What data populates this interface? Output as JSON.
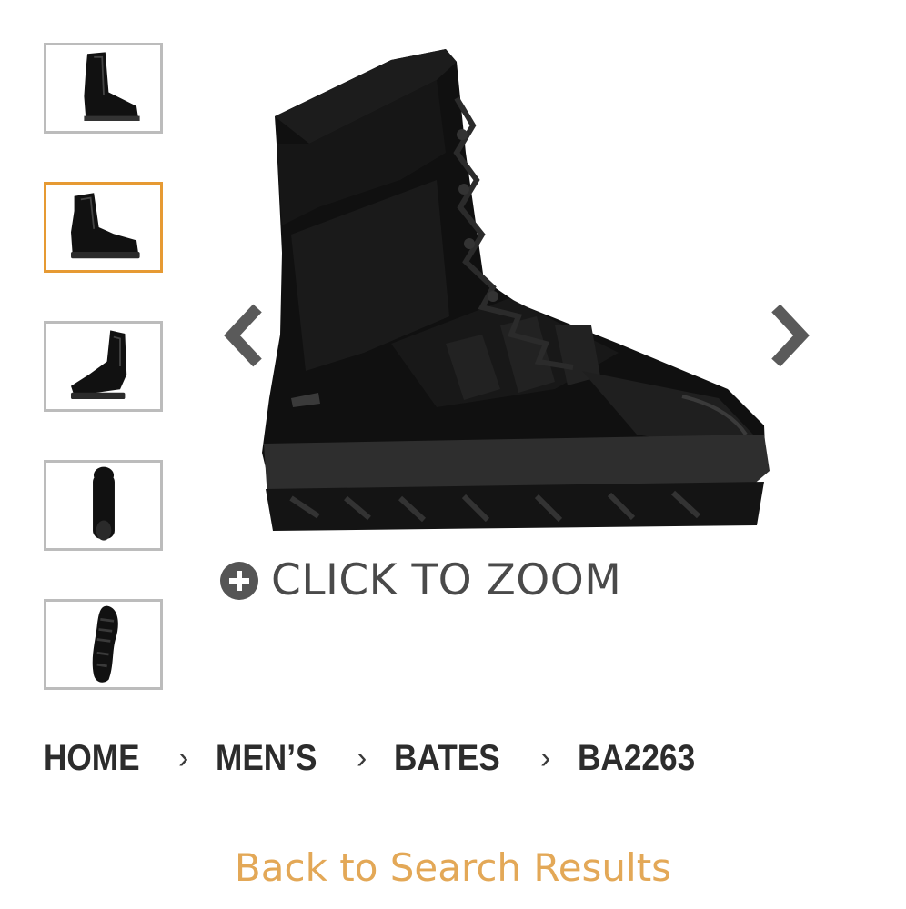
{
  "gallery": {
    "thumbnails": [
      {
        "name": "thumbnail-side-view",
        "selected": false
      },
      {
        "name": "thumbnail-angle-view",
        "selected": true
      },
      {
        "name": "thumbnail-inner-view",
        "selected": false
      },
      {
        "name": "thumbnail-top-view",
        "selected": false
      },
      {
        "name": "thumbnail-sole-view",
        "selected": false
      }
    ],
    "selected_border_color": "#e69a33",
    "prev_icon": "chevron-left-icon",
    "next_icon": "chevron-right-icon",
    "zoom_icon": "plus-circle-icon",
    "zoom_label": "CLICK TO ZOOM"
  },
  "breadcrumb": {
    "items": [
      "HOME",
      "MEN’S",
      "BATES",
      "BA2263"
    ],
    "separator": "›"
  },
  "back_link": "Back to Search Results",
  "colors": {
    "accent": "#e3a857",
    "text_dark": "#2c2c2c",
    "icon_gray": "#555555"
  }
}
